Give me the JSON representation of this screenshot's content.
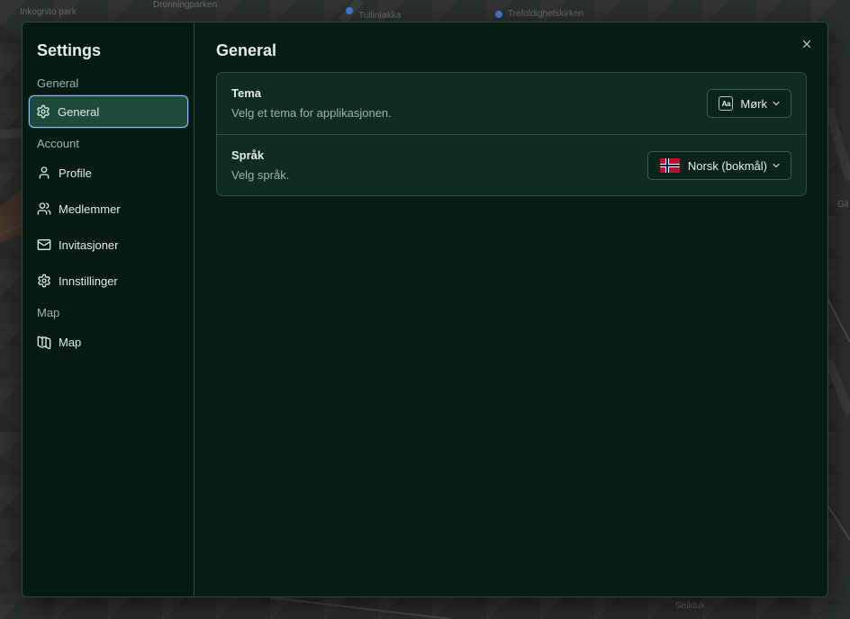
{
  "map": {
    "labels": [
      "Inkognito park",
      "Dronningparken",
      "Tullinløkka",
      "Trefoldighetskirken",
      "Seilduk",
      "Gil"
    ]
  },
  "sidebar": {
    "title": "Settings",
    "groups": [
      {
        "label": "General",
        "items": [
          {
            "label": "General",
            "icon": "gear-icon",
            "active": true
          }
        ]
      },
      {
        "label": "Account",
        "items": [
          {
            "label": "Profile",
            "icon": "user-icon"
          },
          {
            "label": "Medlemmer",
            "icon": "users-icon"
          },
          {
            "label": "Invitasjoner",
            "icon": "mail-icon"
          },
          {
            "label": "Innstillinger",
            "icon": "gear-icon"
          }
        ]
      },
      {
        "label": "Map",
        "items": [
          {
            "label": "Map",
            "icon": "map-icon"
          }
        ]
      }
    ]
  },
  "main": {
    "title": "General",
    "close_icon": "close-icon",
    "rows": [
      {
        "title": "Tema",
        "description": "Velg et tema for applikasjonen.",
        "select": {
          "badge": "Aa",
          "value": "Mørk"
        }
      },
      {
        "title": "Språk",
        "description": "Velg språk.",
        "select": {
          "flag": "norway-flag-icon",
          "value": "Norsk (bokmål)"
        }
      }
    ]
  },
  "colors": {
    "accent_border": "#8ebdf3",
    "active_bg": "#1e4a3d",
    "dialog_bg": "#061c16"
  }
}
